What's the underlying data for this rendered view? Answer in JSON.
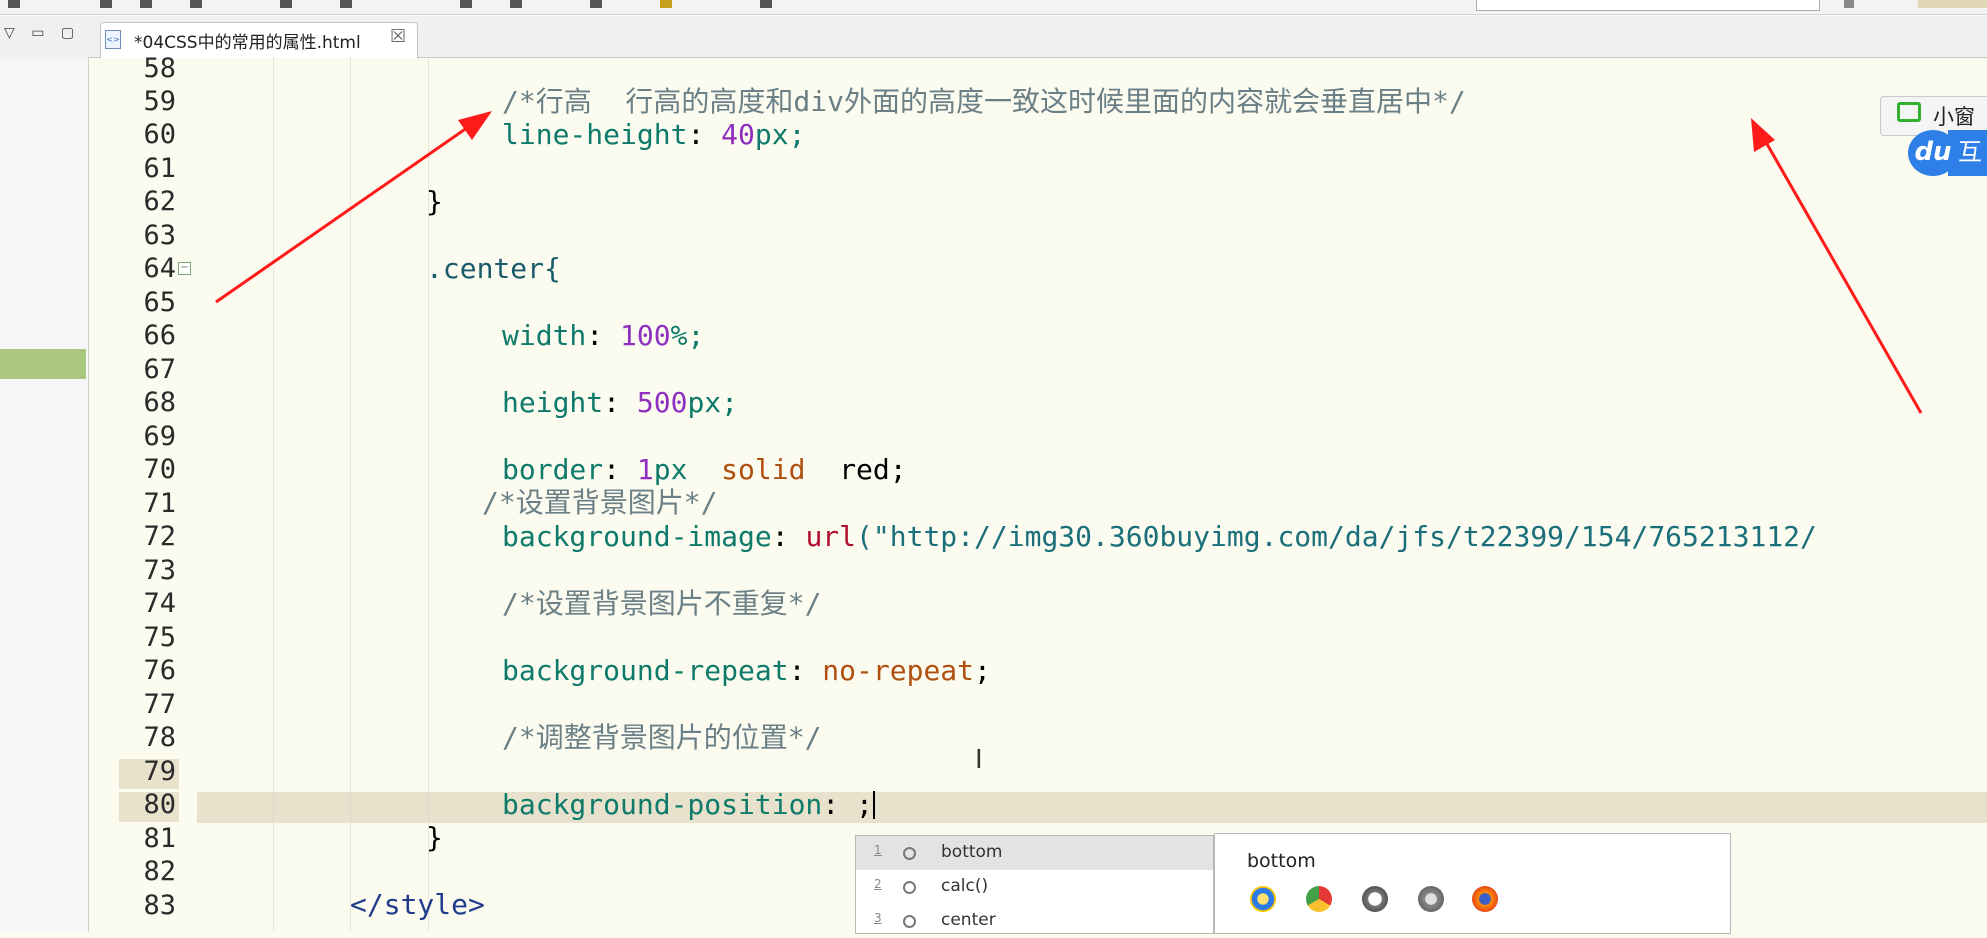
{
  "editor_tab": {
    "title": "*04CSS中的常用的属性.html",
    "close_glyph": "☒"
  },
  "view_controls": "▽ ▭ ▢",
  "line_numbers": [
    "58",
    "59",
    "60",
    "61",
    "62",
    "63",
    "64",
    "65",
    "66",
    "67",
    "68",
    "69",
    "70",
    "71",
    "72",
    "73",
    "74",
    "75",
    "76",
    "77",
    "78",
    "79",
    "80",
    "81",
    "82",
    "83"
  ],
  "code": {
    "l59_comment": "/*行高  行高的高度和div外面的高度一致这时候里面的内容就会垂直居中*/",
    "l60_prop": "line-height",
    "l60_num": "40",
    "l60_unit": "px;",
    "l62": "}",
    "l64_selector": ".center{",
    "l66_prop": "width",
    "l66_num": "100",
    "l66_unit": "%;",
    "l68_prop": "height",
    "l68_num": "500",
    "l68_unit": "px;",
    "l70_prop": "border",
    "l70_num": "1",
    "l70_unit": "px",
    "l70_kw": "solid",
    "l70_color": "red;",
    "l71_comment": "/*设置背景图片*/",
    "l72_prop": "background-image",
    "l72_fn": "url",
    "l72_str": "(\"http://img30.360buyimg.com/da/jfs/t22399/154/765213112/",
    "l74_comment": "/*设置背景图片不重复*/",
    "l76_prop": "background-repeat",
    "l76_kw": "no-repeat",
    "l76_end": ";",
    "l78_comment": "/*调整背景图片的位置*/",
    "l80_prop": "background-position",
    "l80_end": " ;",
    "l81": "}",
    "l83_tag": "</style>"
  },
  "autocomplete": {
    "items": [
      {
        "index": "1",
        "label": "bottom"
      },
      {
        "index": "2",
        "label": "calc()"
      },
      {
        "index": "3",
        "label": "center"
      }
    ],
    "info_title": "bottom",
    "browser_icons": [
      "ie-icon",
      "chrome-icon",
      "safari-icon",
      "opera-icon",
      "firefox-icon"
    ]
  },
  "floating_widget": {
    "label": "小窗",
    "badge_text": "du",
    "badge_tail": "互"
  },
  "colors": {
    "editor_bg": "#fbfbf0",
    "current_line": "#e8e2cd",
    "annotation_arrow": "#ff1a1a",
    "property": "#0e7a6a",
    "number": "#8f2fc0",
    "keyword": "#b05010",
    "comment": "#6a7f86"
  }
}
